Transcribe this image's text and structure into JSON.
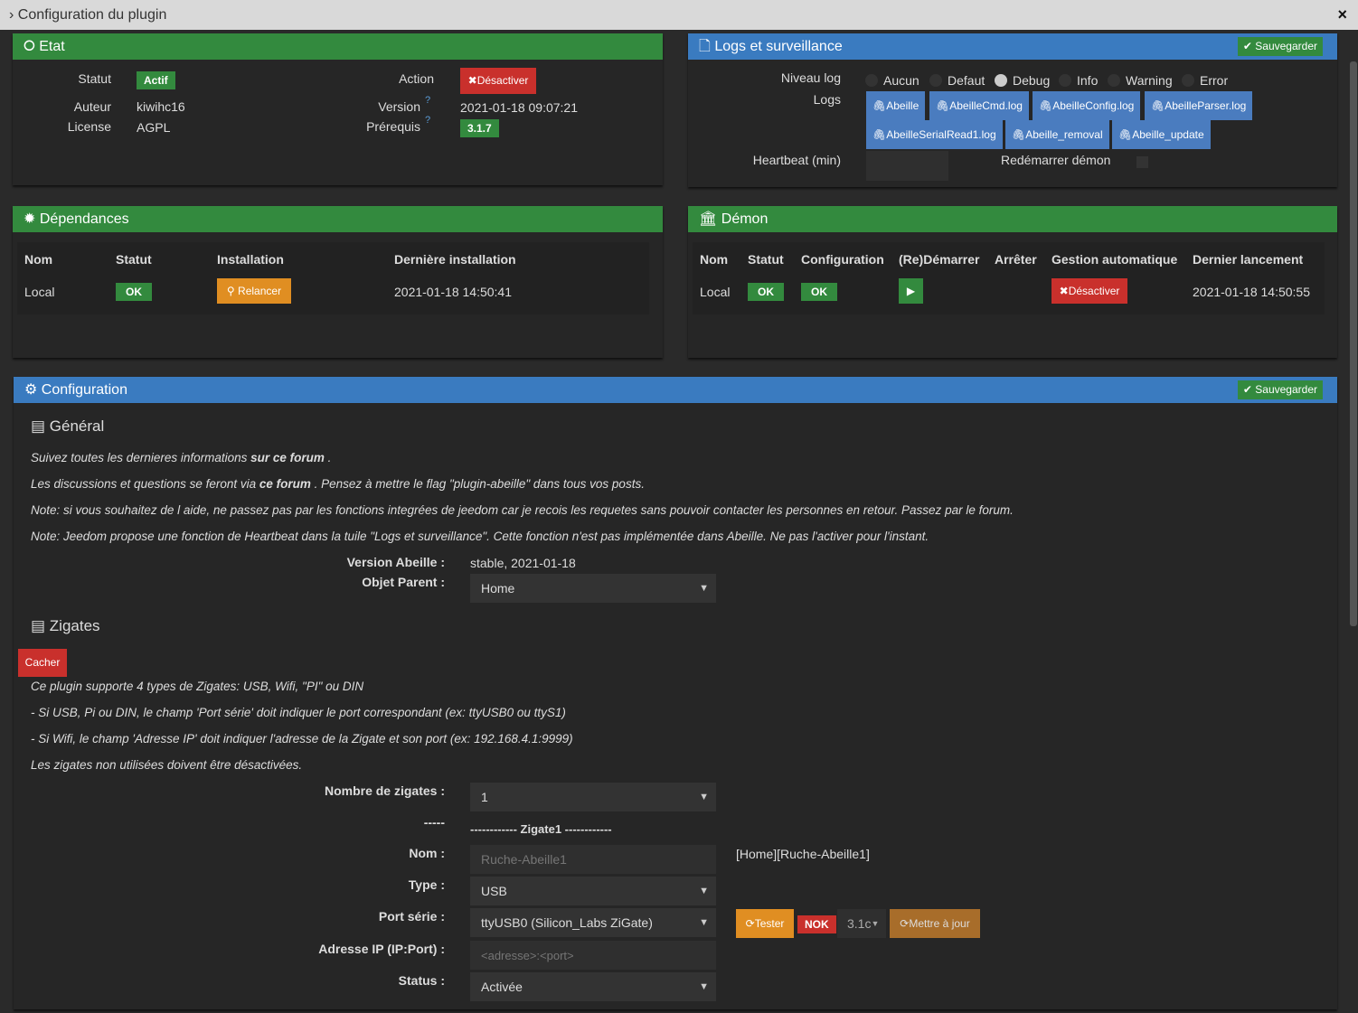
{
  "window": {
    "title": "Configuration du plugin",
    "close": "×"
  },
  "etat": {
    "title": "Etat",
    "statut_label": "Statut",
    "statut": "Actif",
    "auteur_label": "Auteur",
    "auteur": "kiwihc16",
    "license_label": "License",
    "license": "AGPL",
    "action_label": "Action",
    "desactiver": "Désactiver",
    "version_label": "Version",
    "version": "2021-01-18 09:07:21",
    "prerequis_label": "Prérequis",
    "prerequis": "3.1.7"
  },
  "logs": {
    "title": "Logs et surveillance",
    "save": "Sauvegarder",
    "niveau_label": "Niveau log",
    "levels": [
      "Aucun",
      "Defaut",
      "Debug",
      "Info",
      "Warning",
      "Error"
    ],
    "selected_level": "Debug",
    "logs_label": "Logs",
    "files": [
      "Abeille",
      "AbeilleCmd.log",
      "AbeilleConfig.log",
      "AbeilleParser.log",
      "AbeilleSerialRead1.log",
      "Abeille_removal",
      "Abeille_update"
    ],
    "heartbeat_label": "Heartbeat (min)",
    "restart_label": "Redémarrer démon"
  },
  "deps": {
    "title": "Dépendances",
    "headers": [
      "Nom",
      "Statut",
      "Installation",
      "Dernière installation"
    ],
    "row": {
      "nom": "Local",
      "statut": "OK",
      "install": "Relancer",
      "date": "2021-01-18 14:50:41"
    }
  },
  "demon": {
    "title": "Démon",
    "headers": [
      "Nom",
      "Statut",
      "Configuration",
      "(Re)Démarrer",
      "Arrêter",
      "Gestion automatique",
      "Dernier lancement"
    ],
    "row": {
      "nom": "Local",
      "statut": "OK",
      "config": "OK",
      "gestion": "Désactiver",
      "date": "2021-01-18 14:50:55"
    }
  },
  "config": {
    "title": "Configuration",
    "save": "Sauvegarder",
    "general": {
      "title": "Général",
      "l1a": "Suivez toutes les dernieres informations ",
      "l1b": "sur ce forum",
      "l1c": " .",
      "l2a": "Les discussions et questions se feront via ",
      "l2b": "ce forum",
      "l2c": " . Pensez à mettre le flag \"plugin-abeille\" dans tous vos posts.",
      "l3": "Note: si vous souhaitez de l aide, ne passez pas par les fonctions integrées de jeedom car je recois les requetes sans pouvoir contacter les personnes en retour. Passez par le forum.",
      "l4": "Note: Jeedom propose une fonction de Heartbeat dans la tuile \"Logs et surveillance\". Cette fonction n'est pas implémentée dans Abeille. Ne pas l'activer pour l'instant.",
      "version_label": "Version Abeille :",
      "version": "stable, 2021-01-18",
      "parent_label": "Objet Parent :",
      "parent": "Home"
    },
    "zigates": {
      "title": "Zigates",
      "cacher": "Cacher",
      "l1": "Ce plugin supporte 4 types de Zigates: USB, Wifi, \"PI\" ou DIN",
      "l2": "- Si USB, Pi ou DIN, le champ 'Port série' doit indiquer le port correspondant (ex: ttyUSB0 ou ttyS1)",
      "l3": "- Si Wifi, le champ 'Adresse IP' doit indiquer l'adresse de la Zigate et son port (ex: 192.168.4.1:9999)",
      "l4": "Les zigates non utilisées doivent être désactivées.",
      "nombre_label": "Nombre de zigates :",
      "nombre": "1",
      "sep_label": "-----",
      "sep": "------------ Zigate1 ------------",
      "nom_label": "Nom :",
      "nom_placeholder": "Ruche-Abeille1",
      "nom_path": "[Home][Ruche-Abeille1]",
      "type_label": "Type :",
      "type": "USB",
      "port_label": "Port série :",
      "port": "ttyUSB0 (Silicon_Labs ZiGate)",
      "tester": "Tester",
      "nok": "NOK",
      "fw": "3.1c",
      "update": "Mettre à jour",
      "ip_label": "Adresse IP (IP:Port) :",
      "ip_placeholder": "<adresse>:<port>",
      "status_label": "Status :",
      "status": "Activée"
    }
  }
}
